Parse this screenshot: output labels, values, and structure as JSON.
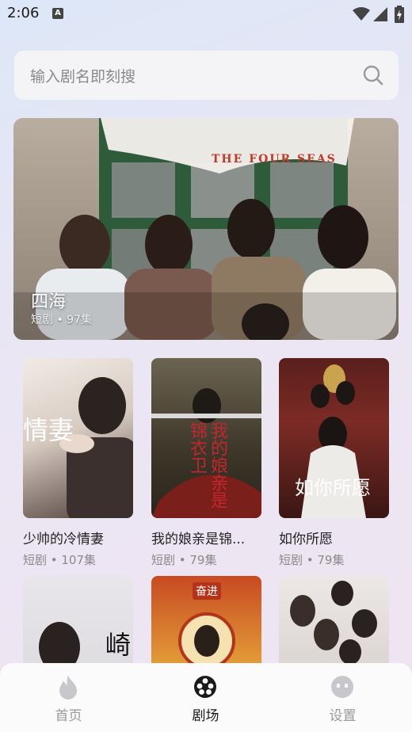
{
  "status": {
    "time": "2:06",
    "a_badge": "A"
  },
  "search": {
    "placeholder": "输入剧名即刻搜"
  },
  "banner": {
    "title": "四海",
    "meta": "短剧 • 97集",
    "poster_caption": "THE FOUR SEAS"
  },
  "cards": [
    {
      "title": "少帅的冷情妻",
      "meta": "短剧 • 107集",
      "poster_text": "情妻"
    },
    {
      "title": "我的娘亲是锦...",
      "meta": "短剧 • 79集",
      "poster_text": "我的娘亲是锦衣卫"
    },
    {
      "title": "如你所愿",
      "meta": "短剧 • 79集",
      "poster_text": "如你所愿"
    },
    {
      "title": "",
      "meta": "",
      "poster_text": "崎"
    },
    {
      "title": "",
      "meta": "",
      "poster_text": "奋进"
    },
    {
      "title": "",
      "meta": "",
      "poster_text": ""
    }
  ],
  "nav": {
    "items": [
      {
        "label": "首页",
        "icon": "flame-icon",
        "active": false
      },
      {
        "label": "剧场",
        "icon": "film-reel-icon",
        "active": true
      },
      {
        "label": "设置",
        "icon": "face-icon",
        "active": false
      }
    ]
  },
  "colors": {
    "active": "#1a1a1a",
    "inactive": "#9a9a9a",
    "icon_inactive": "#c8c8cc"
  }
}
